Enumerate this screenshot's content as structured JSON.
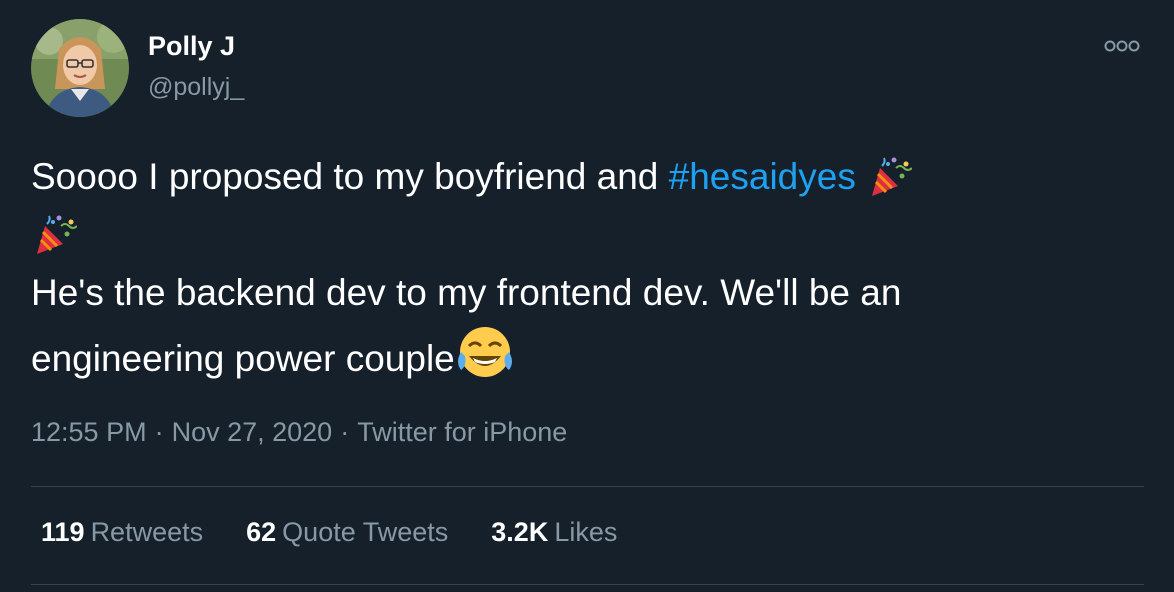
{
  "author": {
    "display_name": "Polly J",
    "handle": "@pollyj_"
  },
  "tweet": {
    "text_part1": "Soooo I proposed to my boyfriend and ",
    "hashtag": "#hesaidyes",
    "line2": "He's the backend dev to my frontend dev. We'll be an",
    "line3": "engineering power couple",
    "emojis": [
      "party-popper-icon",
      "party-popper-icon",
      "tears-of-joy-icon"
    ]
  },
  "meta": {
    "time": "12:55 PM",
    "separator": "·",
    "date": "Nov 27, 2020",
    "source": "Twitter for iPhone"
  },
  "stats": {
    "retweets_count": "119",
    "retweets_label": "Retweets",
    "quotes_count": "62",
    "quotes_label": "Quote Tweets",
    "likes_count": "3.2K",
    "likes_label": "Likes"
  },
  "colors": {
    "background": "#15202b",
    "text": "#ffffff",
    "secondary": "#8899a6",
    "link": "#1da1f2",
    "divider": "#38444d"
  }
}
